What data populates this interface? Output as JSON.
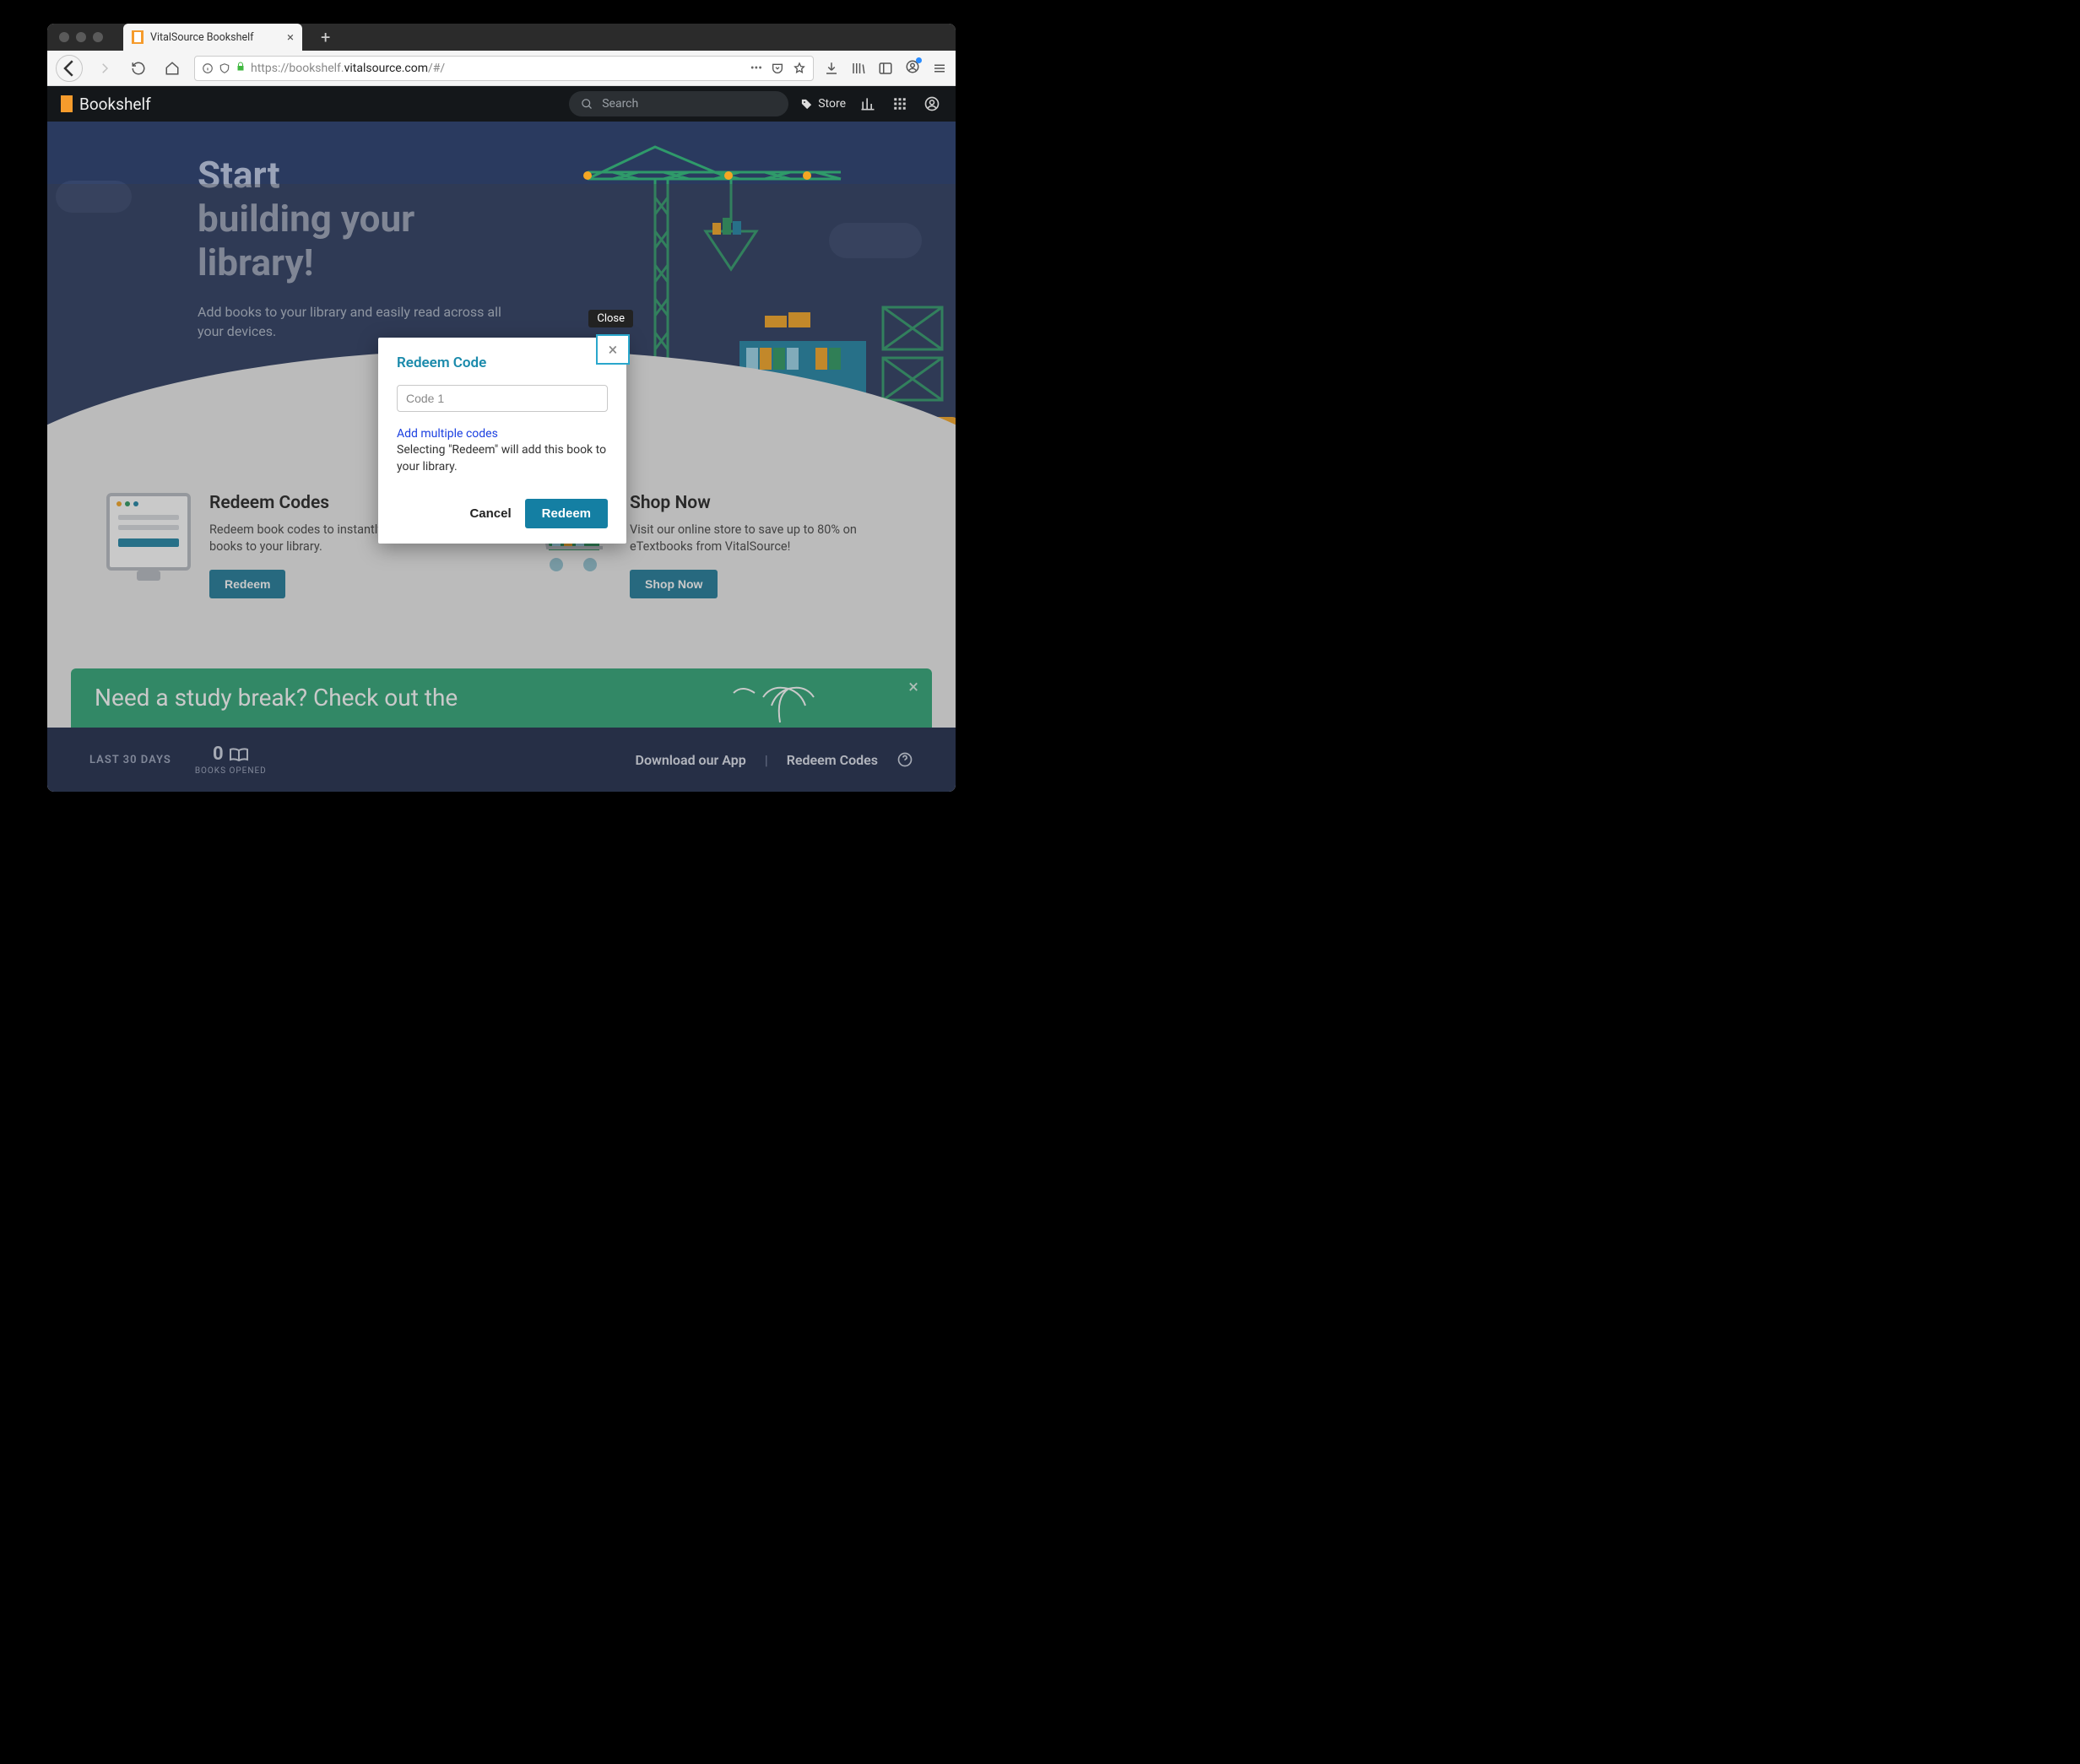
{
  "browser": {
    "tab_title": "VitalSource Bookshelf",
    "url_prefix": "https://bookshelf.",
    "url_host": "vitalsource.com",
    "url_path": "/#/"
  },
  "header": {
    "brand": "Bookshelf",
    "search_placeholder": "Search",
    "store_label": "Store"
  },
  "hero": {
    "title_line1": "Start",
    "title_line2": "building your",
    "title_line3": "library!",
    "subtitle": "Add books to your library and easily read across all your devices."
  },
  "cards": {
    "redeem": {
      "title": "Redeem Codes",
      "body": "Redeem book codes to instantly add books to your library.",
      "button": "Redeem"
    },
    "shop": {
      "title": "Shop Now",
      "body": "Visit our online store to save up to 80% on eTextbooks from VitalSource!",
      "button": "Shop Now"
    }
  },
  "banner": {
    "text": "Need a study break? Check out the"
  },
  "footer": {
    "range_label": "LAST 30 DAYS",
    "books_count": "0",
    "books_label": "BOOKS OPENED",
    "download_app": "Download our App",
    "redeem_codes": "Redeem Codes"
  },
  "modal": {
    "tooltip": "Close",
    "title": "Redeem Code",
    "input_placeholder": "Code 1",
    "multi_link": "Add multiple codes",
    "help_text": "Selecting \"Redeem\" will add this book to your library.",
    "cancel_label": "Cancel",
    "redeem_label": "Redeem"
  }
}
